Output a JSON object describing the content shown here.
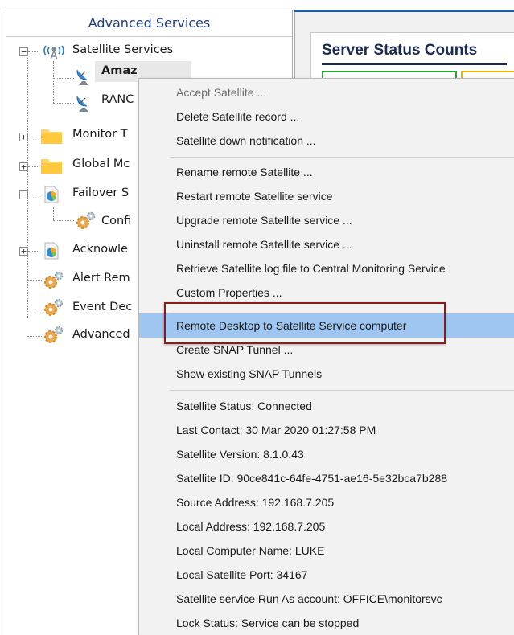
{
  "left_panel": {
    "header": "Advanced Services",
    "tree": [
      {
        "label": "Satellite Services",
        "icon": "satellite-tower-icon",
        "expander": "−"
      },
      {
        "label": "Amaz",
        "icon": "satellite-dish-icon",
        "selected": true
      },
      {
        "label": "RANC",
        "icon": "satellite-dish-icon"
      },
      {
        "label": "Monitor T",
        "icon": "folder-icon",
        "expander": "+"
      },
      {
        "label": "Global Mc",
        "icon": "folder-icon",
        "expander": "+"
      },
      {
        "label": "Failover S",
        "icon": "pie-chart-icon",
        "expander": "−"
      },
      {
        "label": "Confi",
        "icon": "gear-icon"
      },
      {
        "label": "Acknowle",
        "icon": "pie-chart-icon",
        "expander": "+"
      },
      {
        "label": "Alert Rem",
        "icon": "gear-icon"
      },
      {
        "label": "Event Dec",
        "icon": "gear-icon"
      },
      {
        "label": "Advanced",
        "icon": "gear-icon"
      }
    ]
  },
  "right_panel": {
    "status_title": "Server Status Counts",
    "colors": {
      "accent": "#1f5fa8",
      "ok": "#2aa63c",
      "warn": "#e8b800"
    }
  },
  "context_menu": {
    "items": [
      {
        "label": "Accept Satellite ...",
        "disabled": true
      },
      {
        "label": "Delete Satellite record ..."
      },
      {
        "label": "Satellite down notification ..."
      },
      {
        "label": "Rename remote Satellite ..."
      },
      {
        "label": "Restart remote Satellite service"
      },
      {
        "label": "Upgrade remote Satellite service ..."
      },
      {
        "label": "Uninstall remote Satellite service ..."
      },
      {
        "label": "Retrieve Satellite log file to Central Monitoring Service"
      },
      {
        "label": "Custom Properties ..."
      },
      {
        "label": "Remote Desktop to Satellite Service computer",
        "highlighted": true
      },
      {
        "label": "Create SNAP Tunnel ..."
      },
      {
        "label": "Show existing SNAP Tunnels"
      },
      {
        "label": "Satellite Status: Connected"
      },
      {
        "label": "Last Contact: 30 Mar 2020 01:27:58 PM"
      },
      {
        "label": "Satellite Version: 8.1.0.43"
      },
      {
        "label": "Satellite ID: 90ce841c-64fe-4751-ae16-5e32bca7b288"
      },
      {
        "label": "Source Address: 192.168.7.205"
      },
      {
        "label": "Local Address: 192.168.7.205"
      },
      {
        "label": "Local Computer Name: LUKE"
      },
      {
        "label": "Local Satellite Port: 34167"
      },
      {
        "label": "Satellite service Run As account: OFFICE\\monitorsvc"
      },
      {
        "label": "Lock Status: Service can be stopped"
      }
    ]
  }
}
